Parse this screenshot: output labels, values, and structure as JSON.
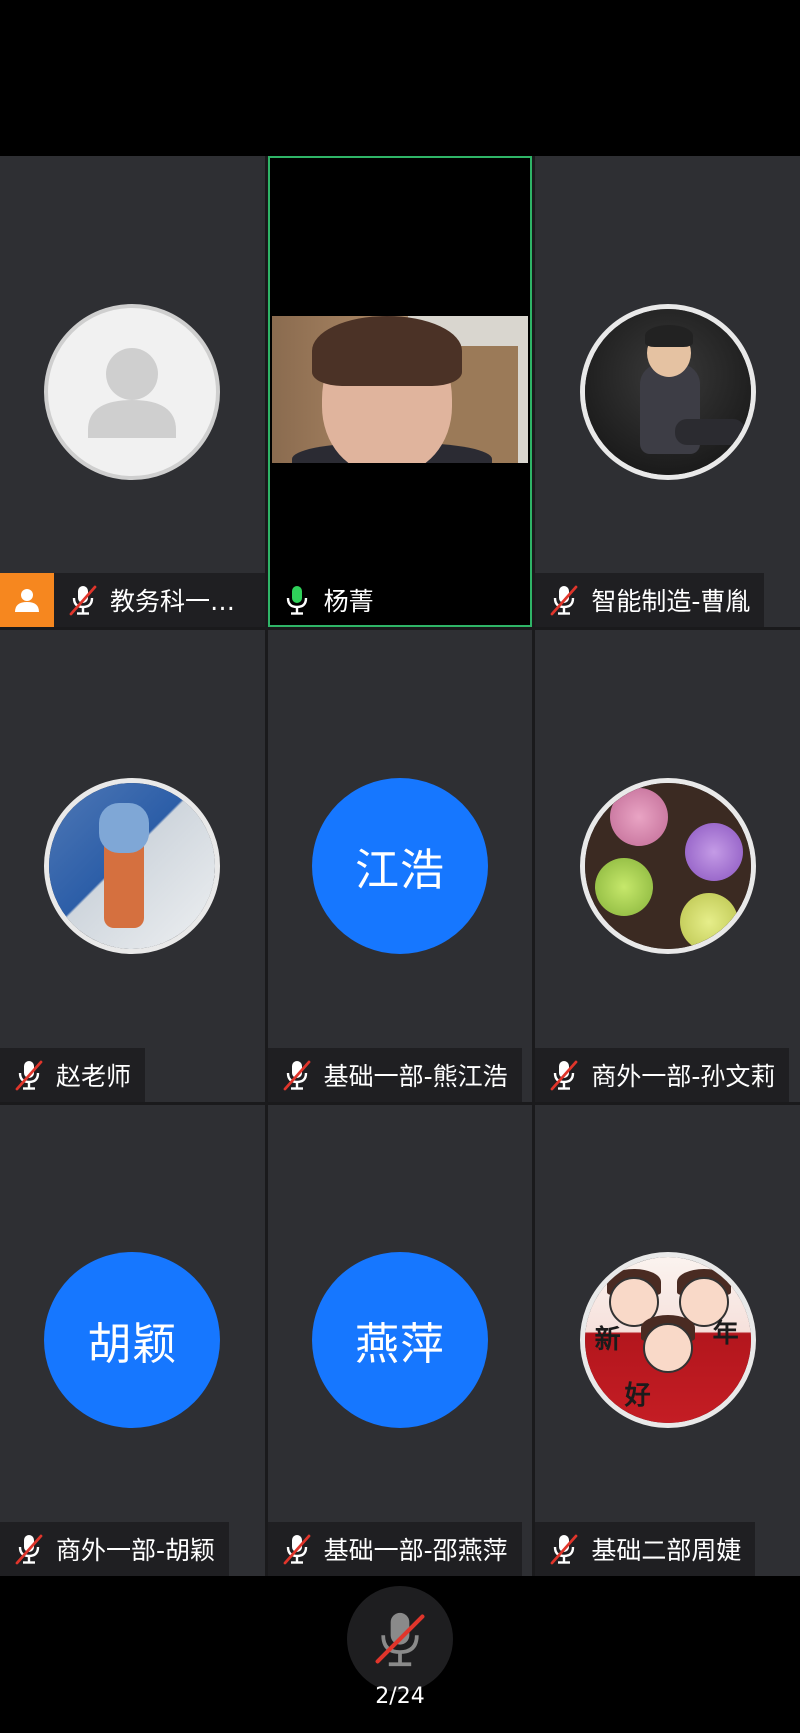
{
  "participants": [
    {
      "name": "教务科一…",
      "avatar": {
        "type": "placeholder",
        "icon": "person-silhouette-icon"
      },
      "mic": "muted",
      "host": true
    },
    {
      "name": "杨菁",
      "avatar": {
        "type": "video"
      },
      "mic": "active",
      "active_speaker": true
    },
    {
      "name": "智能制造-曹胤",
      "avatar": {
        "type": "photo",
        "description_icon": "boy-photo"
      },
      "mic": "muted"
    },
    {
      "name": "赵老师",
      "avatar": {
        "type": "photo"
      },
      "mic": "muted"
    },
    {
      "name": "基础一部-熊江浩",
      "avatar": {
        "type": "text",
        "text": "江浩"
      },
      "mic": "muted"
    },
    {
      "name": "商外一部-孙文莉",
      "avatar": {
        "type": "photo"
      },
      "mic": "muted"
    },
    {
      "name": "商外一部-胡颖",
      "avatar": {
        "type": "text",
        "text": "胡颖"
      },
      "mic": "muted"
    },
    {
      "name": "基础一部-邵燕萍",
      "avatar": {
        "type": "text",
        "text": "燕萍"
      },
      "mic": "muted"
    },
    {
      "name": "基础二部周婕",
      "avatar": {
        "type": "photo",
        "art_text": [
          "新",
          "年",
          "好"
        ]
      },
      "mic": "muted"
    }
  ],
  "bottom": {
    "page_indicator": "2/24",
    "self_mic": "muted"
  },
  "colors": {
    "tile_bg": "#2e2f33",
    "avatar_blue": "#1677ff",
    "active_border": "#2fb467",
    "host_badge": "#f6871f",
    "mic_on": "#2fd15a",
    "mute_slash": "#e0352b"
  }
}
